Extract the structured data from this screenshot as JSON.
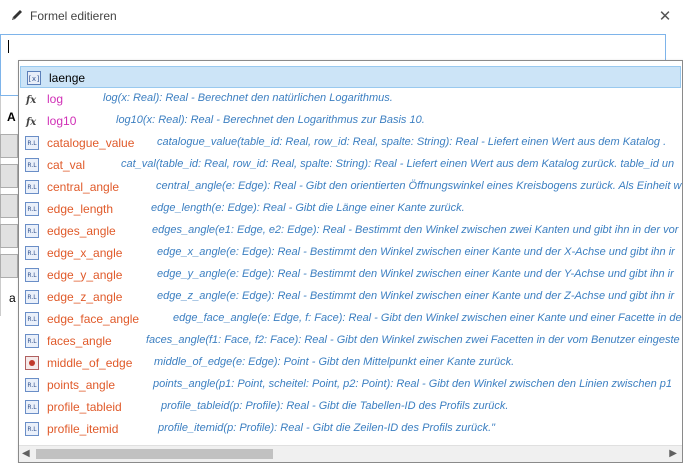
{
  "window": {
    "title": "Formel editieren",
    "close_glyph": "✕"
  },
  "formula": {
    "value": ""
  },
  "background": {
    "letter_a_bold": "A",
    "letter_a": "a"
  },
  "colors": {
    "accent_border": "#7eb4ea",
    "selected_bg": "#cce4f7",
    "variable_color": "#000000",
    "math_color": "#d02fb6",
    "function_color": "#e05a2a",
    "description_color": "#3c7fc1"
  },
  "suggestions": [
    {
      "icon": "variable-icon",
      "name": "laenge",
      "kind": "variable",
      "desc": "",
      "selected": true
    },
    {
      "icon": "fx-icon",
      "name": "log",
      "kind": "math",
      "desc": "log(x: Real): Real - Berechnet den natürlichen Logarithmus."
    },
    {
      "icon": "fx-icon",
      "name": "log10",
      "kind": "math",
      "desc": "log10(x: Real): Real - Berechnet den Logarithmus zur Basis 10."
    },
    {
      "icon": "real-function-icon",
      "name": "catalogue_value",
      "kind": "function",
      "desc": "catalogue_value(table_id: Real, row_id: Real, spalte: String): Real - Liefert einen Wert aus dem Katalog ."
    },
    {
      "icon": "real-function-icon",
      "name": "cat_val",
      "kind": "function",
      "desc": "cat_val(table_id: Real, row_id: Real, spalte: String): Real - Liefert einen Wert aus dem Katalog zurück. table_id un"
    },
    {
      "icon": "real-function-icon",
      "name": "central_angle",
      "kind": "function",
      "desc": "central_angle(e: Edge): Real - Gibt den orientierten Öffnungswinkel eines Kreisbogens zurück. Als Einheit w"
    },
    {
      "icon": "real-function-icon",
      "name": "edge_length",
      "kind": "function",
      "desc": "edge_length(e: Edge): Real - Gibt die Länge einer Kante zurück."
    },
    {
      "icon": "real-function-icon",
      "name": "edges_angle",
      "kind": "function",
      "desc": "edges_angle(e1: Edge, e2: Edge): Real - Bestimmt den Winkel zwischen zwei Kanten und gibt ihn in der vor"
    },
    {
      "icon": "real-function-icon",
      "name": "edge_x_angle",
      "kind": "function",
      "desc": "edge_x_angle(e: Edge): Real - Bestimmt den Winkel zwischen einer Kante und der X-Achse und gibt ihn ir"
    },
    {
      "icon": "real-function-icon",
      "name": "edge_y_angle",
      "kind": "function",
      "desc": "edge_y_angle(e: Edge): Real - Bestimmt den Winkel zwischen einer Kante und der Y-Achse und gibt ihn ir"
    },
    {
      "icon": "real-function-icon",
      "name": "edge_z_angle",
      "kind": "function",
      "desc": "edge_z_angle(e: Edge): Real - Bestimmt den Winkel zwischen einer Kante und der Z-Achse und gibt ihn ir"
    },
    {
      "icon": "real-function-icon",
      "name": "edge_face_angle",
      "kind": "function",
      "desc": "edge_face_angle(e: Edge, f: Face): Real - Gibt den Winkel zwischen einer Kante und einer Facette in de"
    },
    {
      "icon": "real-function-icon",
      "name": "faces_angle",
      "kind": "function",
      "desc": "faces_angle(f1: Face, f2: Face): Real - Gibt den Winkel zwischen zwei Facetten in der vom Benutzer eingeste"
    },
    {
      "icon": "point-function-icon",
      "name": "middle_of_edge",
      "kind": "function",
      "desc": "middle_of_edge(e: Edge): Point - Gibt den Mittelpunkt einer Kante zurück."
    },
    {
      "icon": "real-function-icon",
      "name": "points_angle",
      "kind": "function",
      "desc": "points_angle(p1: Point, scheitel: Point, p2: Point): Real - Gibt den Winkel zwischen den Linien zwischen p1"
    },
    {
      "icon": "real-function-icon",
      "name": "profile_tableid",
      "kind": "function",
      "desc": "profile_tableid(p: Profile): Real - Gibt die Tabellen-ID des Profils zurück."
    },
    {
      "icon": "real-function-icon",
      "name": "profile_itemid",
      "kind": "function",
      "desc": "profile_itemid(p: Profile): Real - Gibt die Zeilen-ID des Profils zurück.\""
    }
  ],
  "scrollbar": {
    "left_glyph": "◀",
    "right_glyph": "▶"
  }
}
